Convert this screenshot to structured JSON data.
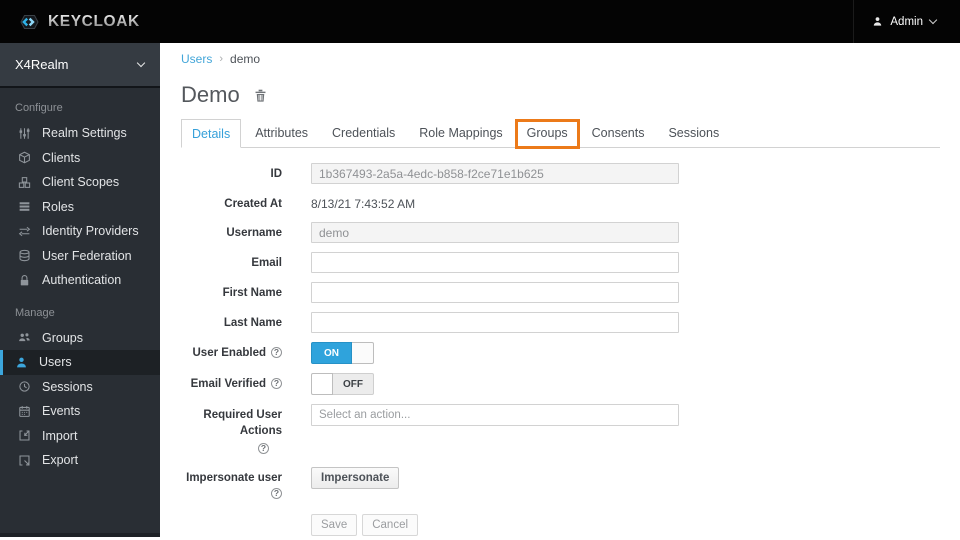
{
  "header": {
    "brand": "KEYCLOAK",
    "user": {
      "label": "Admin"
    }
  },
  "sidebar": {
    "realm_selector": {
      "label": "X4Realm"
    },
    "sections": [
      {
        "label": "Configure",
        "items": [
          {
            "label": "Realm Settings",
            "icon": "sliders-icon"
          },
          {
            "label": "Clients",
            "icon": "cube-icon"
          },
          {
            "label": "Client Scopes",
            "icon": "cubes-icon"
          },
          {
            "label": "Roles",
            "icon": "list-icon"
          },
          {
            "label": "Identity Providers",
            "icon": "exchange-icon"
          },
          {
            "label": "User Federation",
            "icon": "database-icon"
          },
          {
            "label": "Authentication",
            "icon": "lock-icon"
          }
        ]
      },
      {
        "label": "Manage",
        "items": [
          {
            "label": "Groups",
            "icon": "group-icon"
          },
          {
            "label": "Users",
            "icon": "user-icon",
            "active": true
          },
          {
            "label": "Sessions",
            "icon": "clock-icon"
          },
          {
            "label": "Events",
            "icon": "calendar-icon"
          },
          {
            "label": "Import",
            "icon": "import-icon"
          },
          {
            "label": "Export",
            "icon": "export-icon"
          }
        ]
      }
    ]
  },
  "breadcrumb": {
    "separator": "›",
    "items": [
      {
        "label": "Users",
        "link": true
      },
      {
        "label": "demo",
        "link": false
      }
    ]
  },
  "page": {
    "title": "Demo"
  },
  "tabs": [
    {
      "label": "Details",
      "active": true
    },
    {
      "label": "Attributes"
    },
    {
      "label": "Credentials"
    },
    {
      "label": "Role Mappings"
    },
    {
      "label": "Groups",
      "highlighted": true
    },
    {
      "label": "Consents"
    },
    {
      "label": "Sessions"
    }
  ],
  "annotation": {
    "color": "#ec7a19",
    "target": "Groups tab"
  },
  "form": {
    "fields": [
      {
        "label": "ID",
        "type": "text",
        "value": "1b367493-2a5a-4edc-b858-f2ce71e1b625",
        "readonly": true
      },
      {
        "label": "Created At",
        "type": "static",
        "value": "8/13/21 7:43:52 AM"
      },
      {
        "label": "Username",
        "type": "text",
        "value": "demo",
        "readonly": true
      },
      {
        "label": "Email",
        "type": "text",
        "value": ""
      },
      {
        "label": "First Name",
        "type": "text",
        "value": ""
      },
      {
        "label": "Last Name",
        "type": "text",
        "value": ""
      },
      {
        "label": "User Enabled",
        "type": "toggle",
        "state": "ON",
        "help": true
      },
      {
        "label": "Email Verified",
        "type": "toggle",
        "state": "OFF",
        "help": true
      },
      {
        "label": "Required User Actions",
        "type": "select",
        "placeholder": "Select an action...",
        "help": true,
        "help_below": true
      },
      {
        "label": "Impersonate user",
        "type": "button",
        "button_label": "Impersonate",
        "help": true
      }
    ],
    "help_glyph": "?",
    "actions": {
      "save": "Save",
      "cancel": "Cancel"
    }
  },
  "colors": {
    "accent_blue": "#3ca6dc",
    "annotation_orange": "#ec7a19",
    "topbar_bg": "#040404",
    "sidebar_bg": "#292e34"
  }
}
